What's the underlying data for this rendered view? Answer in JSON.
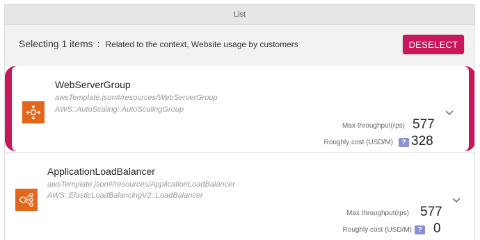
{
  "list": {
    "title": "List"
  },
  "selection": {
    "heading": "Selecting 1 items",
    "separator": ":",
    "context": "Related to the context, Website usage by customers",
    "deselect_label": "DESELECT"
  },
  "colors": {
    "accent": "#c8175a",
    "icon_bg": "#e2661b",
    "badge": "#8a8fd6"
  },
  "resources": [
    {
      "name": "WebServerGroup",
      "path": "awsTemplate.json#/resources/WebServerGroup",
      "type": "AWS::AutoScaling::AutoScalingGroup",
      "icon": "autoscaling-icon",
      "selected": true,
      "throughput_label": "Max throughput(rps)",
      "throughput": "577",
      "cost_label": "Roughly cost (USD/M)",
      "cost_help": "?",
      "cost": "328"
    },
    {
      "name": "ApplicationLoadBalancer",
      "path": "awsTemplate.json#/resources/ApplicationLoadBalancer",
      "type": "AWS::ElasticLoadBalancingV2::LoadBalancer",
      "icon": "load-balancer-icon",
      "selected": false,
      "throughput_label": "Max throughput(rps)",
      "throughput": "577",
      "cost_label": "Roughly cost (USD/M)",
      "cost_help": "?",
      "cost": "0"
    }
  ]
}
